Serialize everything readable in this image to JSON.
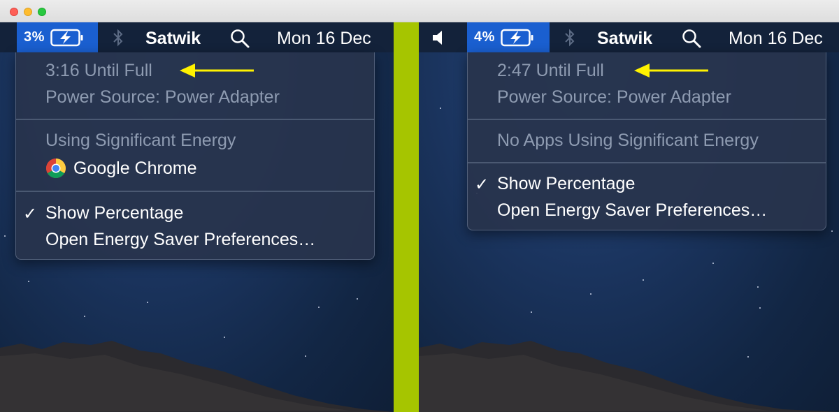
{
  "colors": {
    "divider": "#a6c500",
    "battery_highlight": "#1a5fd0",
    "arrow": "#fff200",
    "menu_disabled_text": "#8e9bb1"
  },
  "left": {
    "menubar": {
      "battery_percent": "3%",
      "bluetooth_icon": "bluetooth-icon",
      "user": "Satwik",
      "search_icon": "search-icon",
      "date": "Mon 16 Dec"
    },
    "menu": {
      "time_until_full": "3:16 Until Full",
      "power_source": "Power Source: Power Adapter",
      "energy_header": "Using Significant Energy",
      "energy_app": "Google Chrome",
      "show_percentage": "Show Percentage",
      "open_prefs": "Open Energy Saver Preferences…"
    }
  },
  "right": {
    "menubar": {
      "volume_icon": "speaker-icon",
      "battery_percent": "4%",
      "bluetooth_icon": "bluetooth-icon",
      "user": "Satwik",
      "search_icon": "search-icon",
      "date": "Mon 16 Dec"
    },
    "menu": {
      "time_until_full": "2:47 Until Full",
      "power_source": "Power Source: Power Adapter",
      "energy_header": "No Apps Using Significant Energy",
      "show_percentage": "Show Percentage",
      "open_prefs": "Open Energy Saver Preferences…"
    }
  }
}
